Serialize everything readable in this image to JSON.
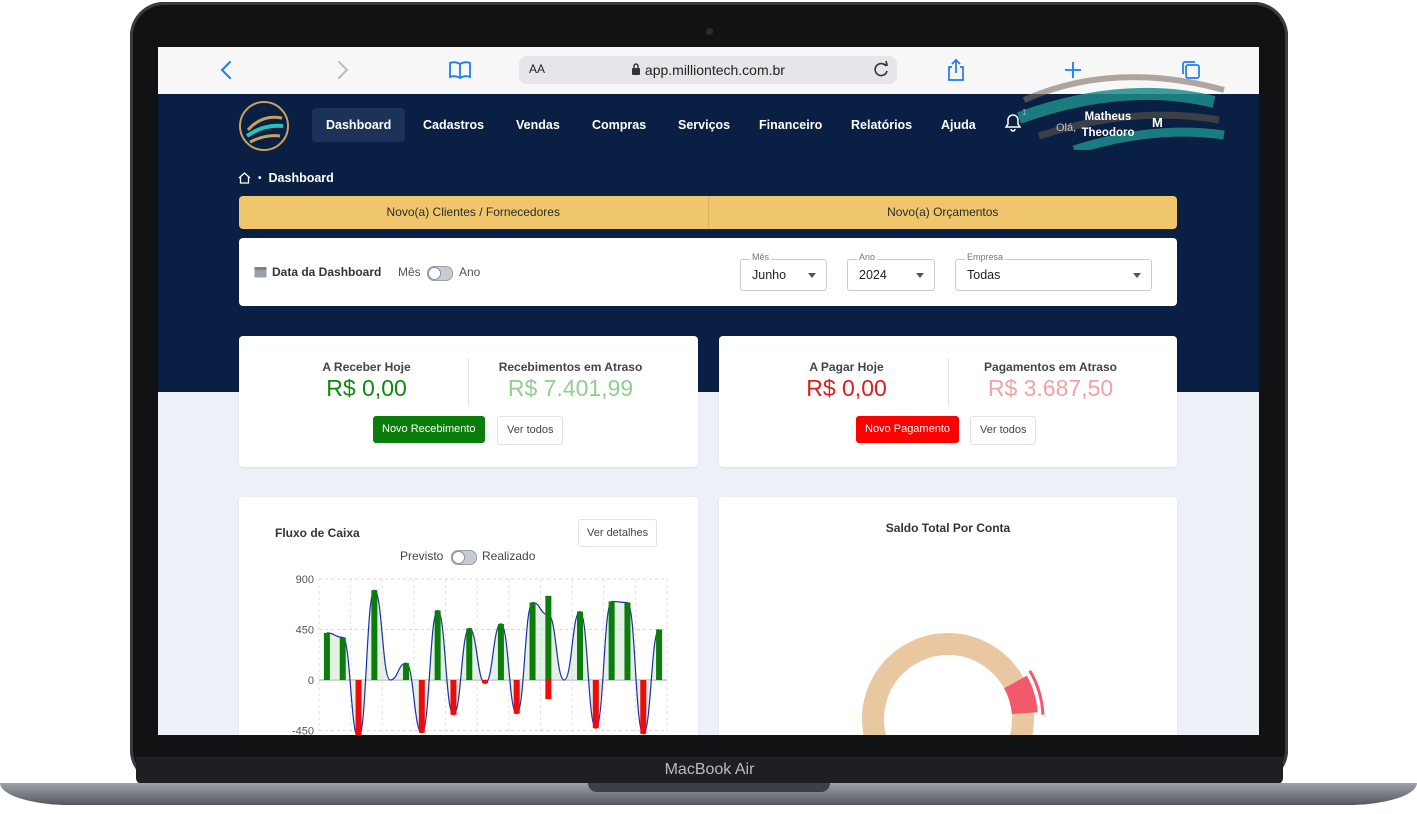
{
  "device": {
    "label": "MacBook Air"
  },
  "browser": {
    "aa": "AA",
    "address": "app.milliontech.com.br"
  },
  "nav": {
    "items": [
      "Dashboard",
      "Cadastros",
      "Vendas",
      "Compras",
      "Serviços",
      "Financeiro",
      "Relatórios",
      "Ajuda"
    ],
    "active": "Dashboard",
    "notification_count": "1",
    "greeting": "Olá,",
    "user_name": "Matheus Theodoro",
    "avatar_initial": "M"
  },
  "breadcrumb": {
    "current": "Dashboard"
  },
  "quick_actions": [
    "Novo(a) Clientes / Fornecedores",
    "Novo(a) Orçamentos"
  ],
  "filter": {
    "label": "Data da Dashboard",
    "toggle_left": "Mês",
    "toggle_right": "Ano",
    "mes": {
      "label": "Mês",
      "value": "Junho"
    },
    "ano": {
      "label": "Ano",
      "value": "2024"
    },
    "empresa": {
      "label": "Empresa",
      "value": "Todas"
    }
  },
  "receber": {
    "hoje_label": "A Receber Hoje",
    "hoje_value": "R$ 0,00",
    "atraso_label": "Recebimentos em Atraso",
    "atraso_value": "R$ 7.401,99",
    "new_button": "Novo Recebimento",
    "see_all": "Ver todos"
  },
  "pagar": {
    "hoje_label": "A Pagar Hoje",
    "hoje_value": "R$ 0,00",
    "atraso_label": "Pagamentos em Atraso",
    "atraso_value": "R$ 3.687,50",
    "new_button": "Novo Pagamento",
    "see_all": "Ver todos"
  },
  "fluxo": {
    "title": "Fluxo de Caixa",
    "details_button": "Ver detalhes",
    "toggle_left": "Previsto",
    "toggle_right": "Realizado"
  },
  "saldo": {
    "title": "Saldo Total Por Conta"
  },
  "colors": {
    "navy": "#0a1f44",
    "yellow": "#f0c66d",
    "green_value": "#0f8a0f",
    "green_light": "#8fd08f",
    "red_value": "#e21d1d",
    "red_light": "#f2a2a2",
    "btn_green": "#0b7d0b",
    "btn_red": "#ff0000",
    "donut_main": "#e8c7a1",
    "donut_accent": "#f25a6c"
  },
  "chart_data": [
    {
      "type": "bar",
      "title": "Fluxo de Caixa",
      "ylim": [
        -450,
        900
      ],
      "yticks": [
        900,
        450,
        0,
        -450
      ],
      "grid": true,
      "series": [
        {
          "color": "green",
          "values": [
            420,
            380,
            0,
            800,
            0,
            150,
            0,
            620,
            0,
            460,
            0,
            500,
            0,
            690,
            750,
            0,
            610,
            0,
            700,
            690,
            0,
            450
          ]
        },
        {
          "color": "red",
          "values": [
            0,
            0,
            -520,
            0,
            0,
            0,
            -470,
            0,
            -310,
            0,
            -30,
            0,
            -300,
            0,
            -170,
            0,
            0,
            -430,
            0,
            0,
            -480,
            0
          ]
        }
      ]
    },
    {
      "type": "pie",
      "title": "Saldo Total Por Conta",
      "slices": [
        {
          "color": "#e8c7a1",
          "share": 0.92
        },
        {
          "color": "#f25a6c",
          "share": 0.08
        }
      ]
    }
  ]
}
